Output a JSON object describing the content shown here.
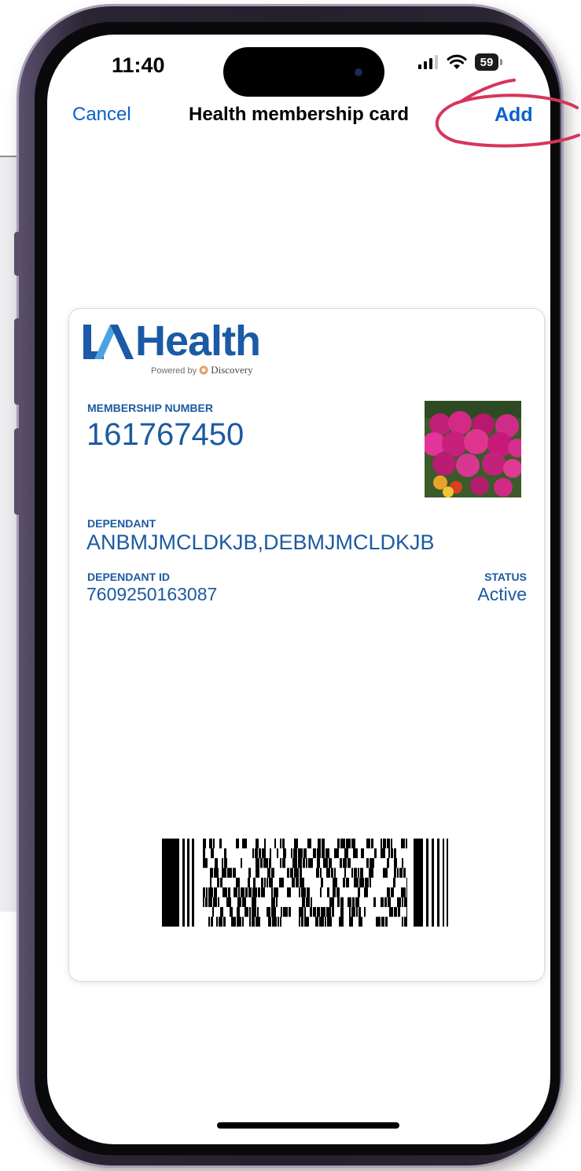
{
  "status_bar": {
    "time": "11:40",
    "battery": "59"
  },
  "nav": {
    "cancel_label": "Cancel",
    "title": "Health membership card",
    "add_label": "Add"
  },
  "card": {
    "logo_text": "Health",
    "logo_sub_prefix": "Powered by",
    "logo_sub_brand": "Discovery",
    "membership_number_label": "MEMBERSHIP NUMBER",
    "membership_number": "161767450",
    "dependant_label": "DEPENDANT",
    "dependant": "ANBMJMCLDKJB,DEBMJMCLDKJB",
    "dependant_id_label": "DEPENDANT ID",
    "dependant_id": "7609250163087",
    "status_label": "STATUS",
    "status": "Active"
  },
  "colors": {
    "accent": "#0a62c9",
    "card_text": "#1c5aa0",
    "annotation": "#d6355a"
  }
}
